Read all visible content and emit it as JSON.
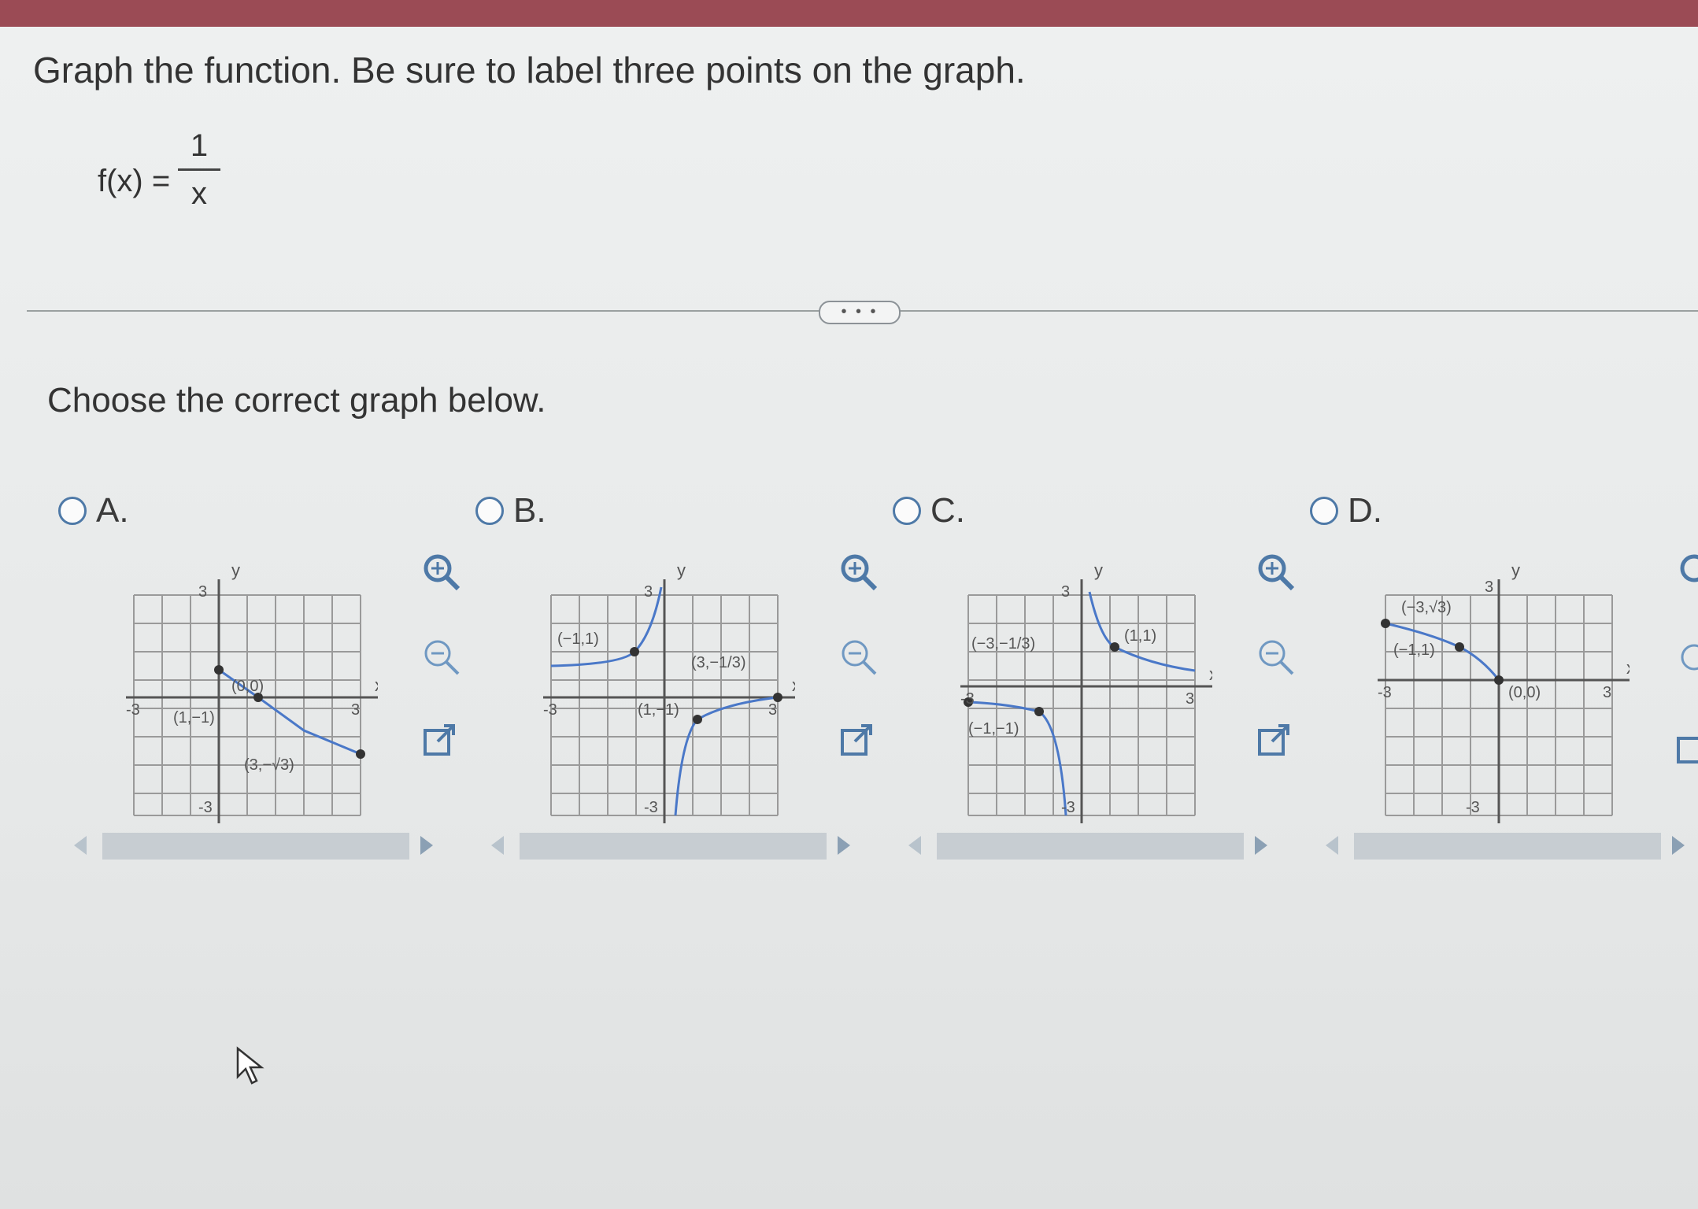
{
  "question": "Graph the function. Be sure to label three points on the graph.",
  "function": {
    "lhs": "f(x) =",
    "numerator": "1",
    "denominator": "x"
  },
  "more_button": "• • •",
  "prompt": "Choose the correct graph below.",
  "options": [
    {
      "label": "A.",
      "axis": {
        "x": "x",
        "y": "y",
        "xmin": "-3",
        "xmax": "3",
        "ymax": "3",
        "ymin": "-3"
      },
      "points": [
        "(0,0)",
        "(1,−1)",
        "(3,−√3)"
      ]
    },
    {
      "label": "B.",
      "axis": {
        "x": "x",
        "y": "y",
        "xmin": "-3",
        "xmax": "3",
        "ymax": "3",
        "ymin": "-3"
      },
      "points": [
        "(−1,1)",
        "(1,−1)",
        "(3,−1/3)"
      ]
    },
    {
      "label": "C.",
      "axis": {
        "x": "x",
        "y": "y",
        "xmin": "-3",
        "xmax": "3",
        "ymax": "3",
        "ymin": "-3"
      },
      "points": [
        "(−3,−1/3)",
        "(1,1)",
        "(−1,−1)"
      ]
    },
    {
      "label": "D.",
      "axis": {
        "x": "x",
        "y": "y",
        "xmin": "-3",
        "xmax": "3",
        "ymax": "3",
        "ymin": "-3"
      },
      "points": [
        "(−3,√3)",
        "(−1,1)",
        "(0,0)"
      ]
    }
  ],
  "colors": {
    "curve": "#4a78c8",
    "grid": "#9a9a9a",
    "radio": "#4e79a7",
    "topbar": "#9b4b55"
  }
}
